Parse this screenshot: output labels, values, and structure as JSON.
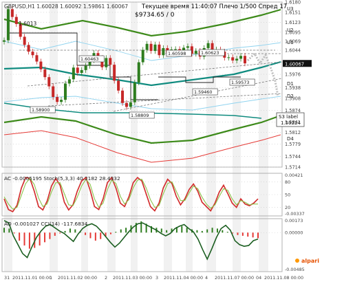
{
  "window": {
    "symbol_line": "GBPUSD,H1  1.60028 1.60092 1.59861 1.60067",
    "subtitle_1": "Текущее время 11:40:07 Плечо 1/500 Спред 17",
    "subtitle_2": "$9734.65    / 0",
    "subtitle_3": "1.6013"
  },
  "colors": {
    "price_up": "#2e7d1f",
    "price_down": "#c62828",
    "band_outer": "#3d8a1a",
    "band_mid": "#0f8b7f",
    "band_inner": "#8fd3ef",
    "lower_red": "#e53935",
    "oscillator_green": "#2e7d1f",
    "oscillator_red": "#d32f2f",
    "macd_red": "#e53935",
    "grid": "#c8c8c8",
    "shade": "#e6e6e6"
  },
  "chart_data": [
    {
      "type": "line",
      "name": "main",
      "title": "GBPUSD,H1",
      "y_range": [
        1.5714,
        1.618
      ],
      "price_labels": [
        "1.6180",
        "1.6151",
        "1.6123",
        "1.6095",
        "1.6069",
        "1.6044",
        "1.6005",
        "1.5976",
        "1.5938",
        "1.5908",
        "1.5874",
        "1.5841",
        "1.5812",
        "1.5779",
        "1.5744",
        "1.5714"
      ],
      "current_price": "1.60067",
      "level_labels": [
        "U3",
        "U2",
        "U1",
        "LB",
        "D1",
        "D2",
        "D4"
      ],
      "annotations": [
        "1.60463",
        "1.60598",
        "1.60623",
        "1.59460",
        "1.59573",
        "1.58900",
        "1.58809"
      ],
      "s3_label": "S3 label",
      "s3_value": "1.59224",
      "brand": "alpari",
      "price_points": [
        1.6072,
        1.616,
        1.6138,
        1.6118,
        1.6082,
        1.6059,
        1.604,
        1.603,
        1.6012,
        1.599,
        1.5968,
        1.5942,
        1.5912,
        1.5898,
        1.5904,
        1.595,
        1.5962,
        1.5995,
        1.598,
        1.5988,
        1.6,
        1.6016,
        1.6036,
        1.6022,
        1.5996,
        1.6022,
        1.6003,
        1.5958,
        1.593,
        1.5895,
        1.5884,
        1.5897,
        1.5953,
        1.601,
        1.6045,
        1.6062,
        1.6042,
        1.606,
        1.603,
        1.605,
        1.6037,
        1.6046,
        1.6047,
        1.6035,
        1.6051,
        1.6055,
        1.6034,
        1.6042,
        1.6026,
        1.605,
        1.6064,
        1.6036,
        1.6046,
        1.604,
        1.6023,
        1.6024,
        1.6015,
        1.602,
        1.6028,
        1.6007
      ]
    },
    {
      "type": "line",
      "name": "oscillator",
      "title": "AC -0.0005195  Stoch(5,3,3) 40.2182  28.4332",
      "y_range": [
        0,
        100
      ],
      "labels": [
        "0.00421",
        "80",
        "50",
        "20",
        "-0.00337"
      ],
      "series": [
        {
          "name": "Stoch main",
          "values": [
            40,
            15,
            10,
            25,
            65,
            90,
            88,
            58,
            22,
            14,
            35,
            70,
            88,
            72,
            32,
            14,
            26,
            58,
            82,
            90,
            60,
            22,
            15,
            40,
            78,
            90,
            65,
            30,
            22,
            45,
            78,
            90,
            82,
            52,
            22,
            12,
            30,
            66,
            86,
            76,
            46,
            26,
            40,
            62,
            75,
            58,
            32,
            22,
            12,
            30,
            56,
            72,
            52,
            30,
            20,
            40,
            28,
            24,
            30,
            40
          ]
        },
        {
          "name": "Stoch signal",
          "values": [
            45,
            28,
            16,
            20,
            48,
            76,
            88,
            74,
            42,
            22,
            28,
            56,
            78,
            78,
            52,
            26,
            24,
            44,
            70,
            86,
            74,
            40,
            20,
            30,
            62,
            84,
            76,
            46,
            28,
            38,
            66,
            84,
            86,
            66,
            38,
            20,
            24,
            52,
            76,
            80,
            58,
            36,
            36,
            54,
            70,
            64,
            44,
            28,
            18,
            26,
            46,
            64,
            60,
            40,
            26,
            36,
            32,
            26,
            28,
            28
          ]
        }
      ]
    },
    {
      "type": "bar",
      "name": "macd",
      "title": "AO -0.001027  CCI(14) -117.6834",
      "y_range": [
        -0.00485,
        0.00173
      ],
      "labels": [
        "0.00173",
        "0.00000",
        "-0.00485"
      ],
      "macd_bars": [
        0.0006,
        0.0005,
        -0.0001,
        -0.001,
        -0.0016,
        -0.002,
        -0.0019,
        -0.0016,
        -0.0012,
        -0.0008,
        -0.0004,
        -0.0001,
        0.0002,
        0.0005,
        0.0004,
        0.0001,
        -0.0003,
        -0.0007,
        -0.001,
        -0.0008,
        -0.0005,
        -0.0002,
        0.0001,
        0.0004,
        0.0006,
        0.0009,
        0.0012,
        0.0014,
        0.0011,
        0.0008,
        0.0006,
        0.0005,
        0.0003,
        0.0005,
        0.0007,
        0.0008,
        0.0006,
        0.0004,
        0.0003,
        0.0002,
        0.0004,
        0.0006,
        0.0005,
        0.0003,
        0.0001,
        -0.0001,
        -0.0003,
        -0.0004,
        -0.0005,
        -0.0006,
        -0.0007
      ],
      "cci_values": [
        0.0015,
        0.0012,
        -0.0004,
        -0.0015,
        -0.0026,
        -0.0031,
        -0.0018,
        -0.0006,
        0.0002,
        0.0008,
        0.001,
        0.0006,
        0.0002,
        -0.0001,
        -0.0006,
        -0.0011,
        -0.0002,
        0.0005,
        0.0009,
        0.0011,
        0.0008,
        0.0002,
        -0.0005,
        -0.0012,
        -0.0018,
        -0.0013,
        -0.0006,
        0.0001,
        0.0007,
        0.0011,
        0.0012,
        0.0009,
        0.0006,
        0.0003,
        -0.0001,
        -0.0004,
        -0.0001,
        0.0005,
        0.0008,
        0.001,
        0.0005,
        0.0001,
        -0.0008,
        -0.0021,
        -0.0033,
        -0.002,
        -0.0006,
        0.0005,
        0.0009,
        0.0003,
        -0.001,
        -0.0015,
        -0.0017,
        -0.0016,
        -0.001,
        -0.0008
      ]
    }
  ],
  "xaxis_labels": [
    "31",
    "2011.11.01 00:00",
    "1",
    "2011.11.02 00:00",
    "2",
    "2011.11.03 00:00",
    "3",
    "2011.11.04 00:00",
    "4",
    "2011.11.07 00:00",
    "04",
    "2011.11.08 00:00"
  ]
}
